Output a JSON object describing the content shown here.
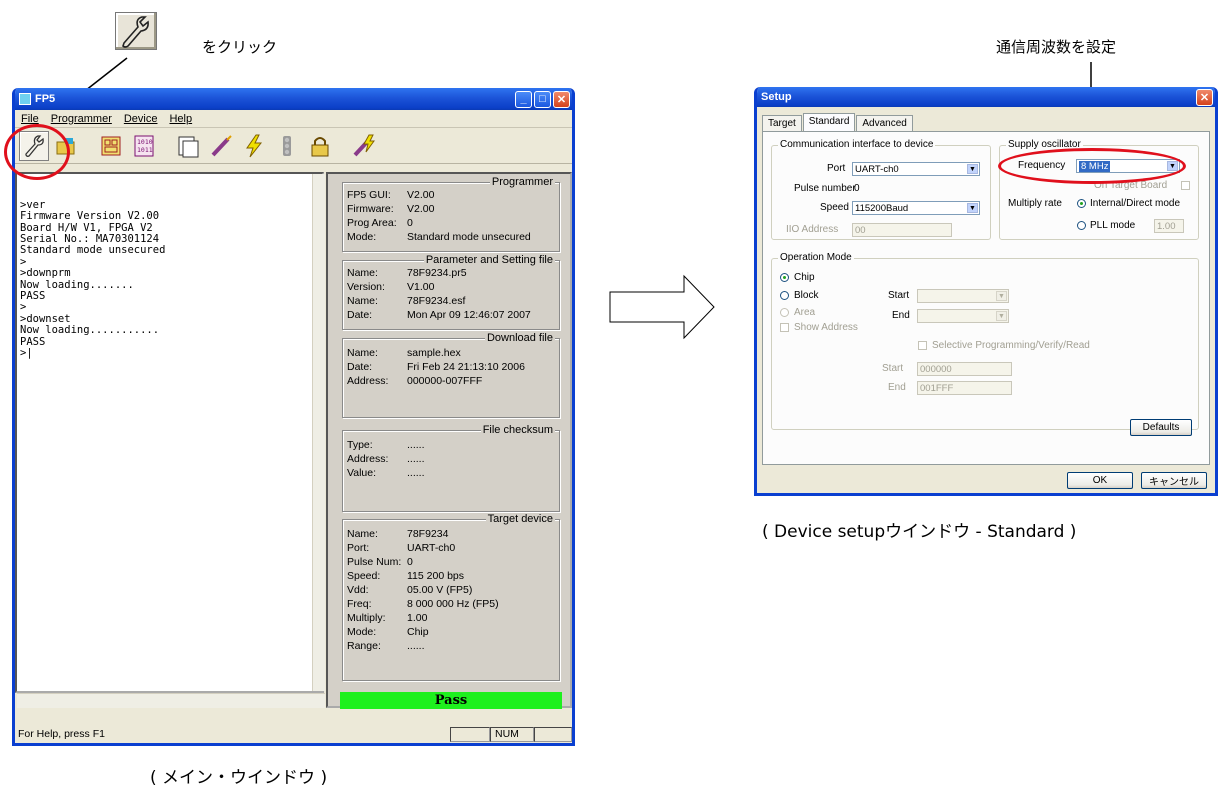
{
  "annotations": {
    "click_text": "をクリック",
    "freq_text": "通信周波数を設定",
    "main_caption": "( メイン・ウインドウ )",
    "setup_caption": "( Device setupウインドウ - Standard )"
  },
  "main_window": {
    "title": "FP5",
    "menu": [
      "File",
      "Programmer",
      "Device",
      "Help"
    ],
    "terminal_lines": [
      ">ver",
      "Firmware Version V2.00",
      "Board H/W V1, FPGA V2",
      "Serial No.: MA70301124",
      "Standard mode unsecured",
      ">",
      ">downprm",
      "Now loading.......",
      "PASS",
      ">",
      ">downset",
      "Now loading...........",
      "PASS",
      ">|"
    ],
    "programmer": {
      "title": "Programmer",
      "rows": [
        {
          "k": "FP5 GUI:",
          "v": "V2.00"
        },
        {
          "k": "Firmware:",
          "v": "V2.00"
        },
        {
          "k": "Prog Area:",
          "v": "0"
        },
        {
          "k": "Mode:",
          "v": "Standard mode unsecured"
        }
      ]
    },
    "param_file": {
      "title": "Parameter and Setting file",
      "rows": [
        {
          "k": "Name:",
          "v": "78F9234.pr5"
        },
        {
          "k": "Version:",
          "v": "V1.00"
        },
        {
          "k": "Name:",
          "v": "78F9234.esf"
        },
        {
          "k": "Date:",
          "v": "Mon Apr 09 12:46:07 2007"
        }
      ]
    },
    "download_file": {
      "title": "Download file",
      "rows": [
        {
          "k": "Name:",
          "v": "sample.hex"
        },
        {
          "k": "Date:",
          "v": "Fri Feb 24 21:13:10 2006"
        },
        {
          "k": "Address:",
          "v": "000000-007FFF"
        }
      ]
    },
    "file_checksum": {
      "title": "File checksum",
      "rows": [
        {
          "k": "Type:",
          "v": "......"
        },
        {
          "k": "Address:",
          "v": "......"
        },
        {
          "k": "Value:",
          "v": "......"
        }
      ]
    },
    "target_device": {
      "title": "Target device",
      "rows": [
        {
          "k": "Name:",
          "v": "78F9234"
        },
        {
          "k": "Port:",
          "v": "UART-ch0"
        },
        {
          "k": "Pulse Num:",
          "v": "0"
        },
        {
          "k": "Speed:",
          "v": "115 200 bps"
        },
        {
          "k": "Vdd:",
          "v": "05.00 V (FP5)"
        },
        {
          "k": "Freq:",
          "v": "8 000 000 Hz (FP5)"
        },
        {
          "k": "Multiply:",
          "v": "1.00"
        },
        {
          "k": "Mode:",
          "v": "Chip"
        },
        {
          "k": "Range:",
          "v": "......"
        }
      ]
    },
    "pass_label": "Pass",
    "status_text": "For Help, press F1",
    "status_num": "NUM"
  },
  "setup_dialog": {
    "title": "Setup",
    "tabs": [
      "Target",
      "Standard",
      "Advanced"
    ],
    "comm_group": "Communication interface to device",
    "port_label": "Port",
    "port_value": "UART-ch0",
    "pulse_label": "Pulse number",
    "pulse_value": "0",
    "speed_label": "Speed",
    "speed_value": "115200Baud",
    "iio_label": "IIO Address",
    "iio_value": "00",
    "osc_group": "Supply oscillator",
    "freq_label": "Frequency",
    "freq_value": "8 MHz",
    "on_target_label": "On Target Board",
    "multiply_label": "Multiply rate",
    "internal_label": "Internal/Direct mode",
    "pll_label": "PLL mode",
    "pll_value": "1.00",
    "op_group": "Operation Mode",
    "chip_label": "Chip",
    "block_label": "Block",
    "area_label": "Area",
    "show_addr_label": "Show Address",
    "start_label": "Start",
    "end_label": "End",
    "selective_label": "Selective Programming/Verify/Read",
    "start2_label": "Start",
    "start2_value": "000000",
    "end2_label": "End",
    "end2_value": "001FFF",
    "defaults_btn": "Defaults",
    "ok_btn": "OK",
    "cancel_btn": "キャンセル"
  },
  "colors": {
    "xp_blue": "#0a3fd0",
    "pass_green": "#1ef01e",
    "highlight_red": "#e0101c"
  }
}
